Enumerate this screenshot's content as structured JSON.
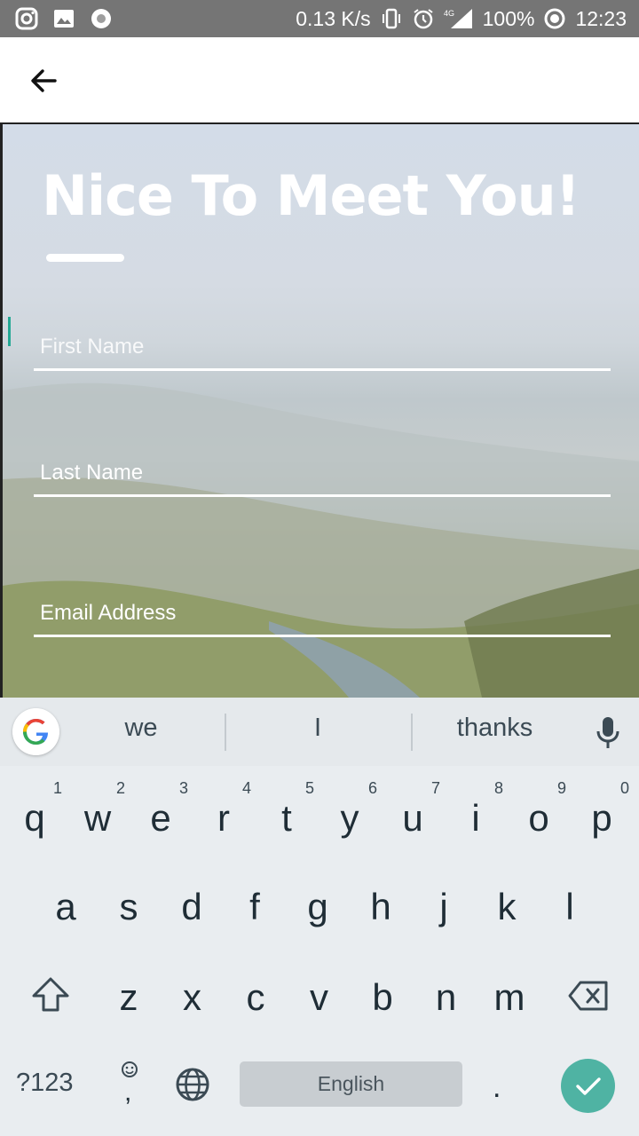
{
  "status_bar": {
    "net_speed": "0.13 K/s",
    "network": "4G",
    "battery": "100%",
    "time": "12:23",
    "icons": [
      "instagram-icon",
      "gallery-icon",
      "record-icon",
      "vibrate-icon",
      "alarm-icon",
      "signal-icon",
      "battery-ring-icon"
    ]
  },
  "app_bar": {
    "back_icon": "arrow-left-icon"
  },
  "form": {
    "title": "Nice To Meet You!",
    "fields": [
      {
        "placeholder": "First Name",
        "value": ""
      },
      {
        "placeholder": "Last Name",
        "value": ""
      },
      {
        "placeholder": "Email Address",
        "value": ""
      }
    ],
    "caret_color": "#23a894"
  },
  "keyboard": {
    "suggestions": [
      "we",
      "I",
      "thanks"
    ],
    "row1": [
      {
        "l": "q",
        "n": "1"
      },
      {
        "l": "w",
        "n": "2"
      },
      {
        "l": "e",
        "n": "3"
      },
      {
        "l": "r",
        "n": "4"
      },
      {
        "l": "t",
        "n": "5"
      },
      {
        "l": "y",
        "n": "6"
      },
      {
        "l": "u",
        "n": "7"
      },
      {
        "l": "i",
        "n": "8"
      },
      {
        "l": "o",
        "n": "9"
      },
      {
        "l": "p",
        "n": "0"
      }
    ],
    "row2": [
      "a",
      "s",
      "d",
      "f",
      "g",
      "h",
      "j",
      "k",
      "l"
    ],
    "row3": [
      "z",
      "x",
      "c",
      "v",
      "b",
      "n",
      "m"
    ],
    "symbols_label": "?123",
    "comma_label": ",",
    "space_label": "English",
    "period_label": ".",
    "accent_color": "#4fb3a3"
  }
}
